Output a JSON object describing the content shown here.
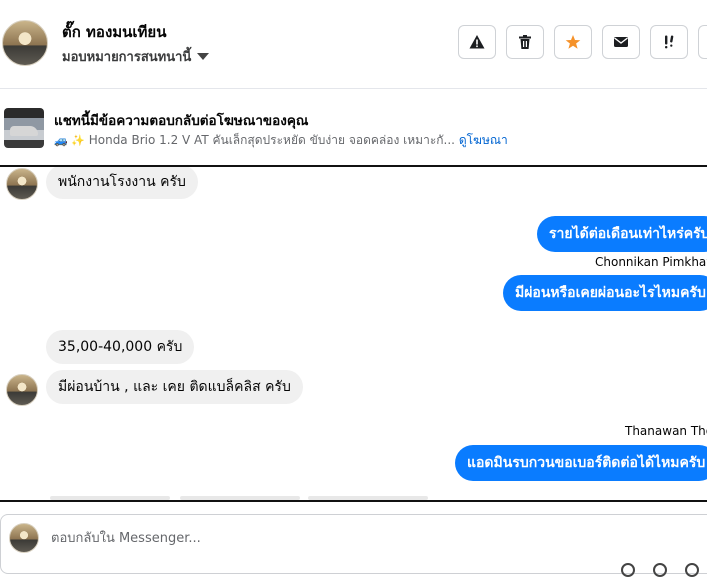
{
  "header": {
    "contact_name": "ตั๊ก ทองมนเทียน",
    "assign_label": "มอบหมายการสนทนานี้",
    "actions": [
      "spam-warning",
      "delete",
      "star",
      "mark-unread",
      "follow-up"
    ]
  },
  "ad": {
    "title": "แชทนี้มีข้อความตอบกลับต่อโฆษณาของคุณ",
    "emoji": "🚙 ✨",
    "description": "Honda Brio 1.2 V AT คันเล็กสุดประหยัด ขับง่าย จอดคล่อง เหมาะกั...",
    "link": "ดูโฆษณา"
  },
  "messages": [
    {
      "dir": "in",
      "text": "พนักงานโรงงาน ครับ"
    },
    {
      "dir": "out",
      "text": "รายได้ต่อเดือนเท่าไหร่ครับ"
    },
    {
      "dir": "sender",
      "text": "Chonnikan Pimkhaw"
    },
    {
      "dir": "out",
      "text": "มีผ่อนหรือเคยผ่อนอะไรไหมครับ"
    },
    {
      "dir": "in",
      "text": "35,00-40,000 ครับ"
    },
    {
      "dir": "in",
      "text": "มีผ่อนบ้าน , และ เคย ติดแบล็คลิส ครับ"
    },
    {
      "dir": "sender",
      "text": "Thanawan Thongdee"
    },
    {
      "dir": "out",
      "text": "แอดมินรบกวนขอเบอร์ติดต่อได้ไหมครับ"
    }
  ],
  "composer": {
    "placeholder": "ตอบกลับใน Messenger..."
  },
  "colors": {
    "accent": "#0a7cff",
    "star": "#f5922a",
    "incoming_bubble": "#f0f0f0"
  }
}
